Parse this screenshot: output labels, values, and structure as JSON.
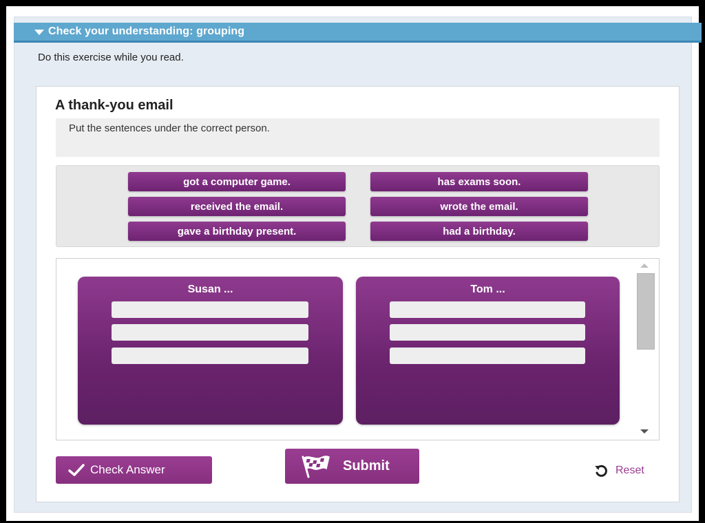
{
  "header": {
    "title": "Check your understanding: grouping"
  },
  "instructions": "Do this exercise while you read.",
  "activity": {
    "title": "A thank-you email",
    "prompt": "Put the sentences under the correct person."
  },
  "chips": [
    "got a computer game.",
    "has exams soon.",
    "received the email.",
    "wrote the email.",
    "gave a birthday present.",
    "had a birthday."
  ],
  "buckets": [
    {
      "label": "Susan ...",
      "slots": 3
    },
    {
      "label": "Tom ...",
      "slots": 3
    }
  ],
  "buttons": {
    "check": "Check Answer",
    "submit": "Submit",
    "reset": "Reset"
  },
  "colors": {
    "accent": "#8e3a8e",
    "header": "#5ea7cf"
  }
}
